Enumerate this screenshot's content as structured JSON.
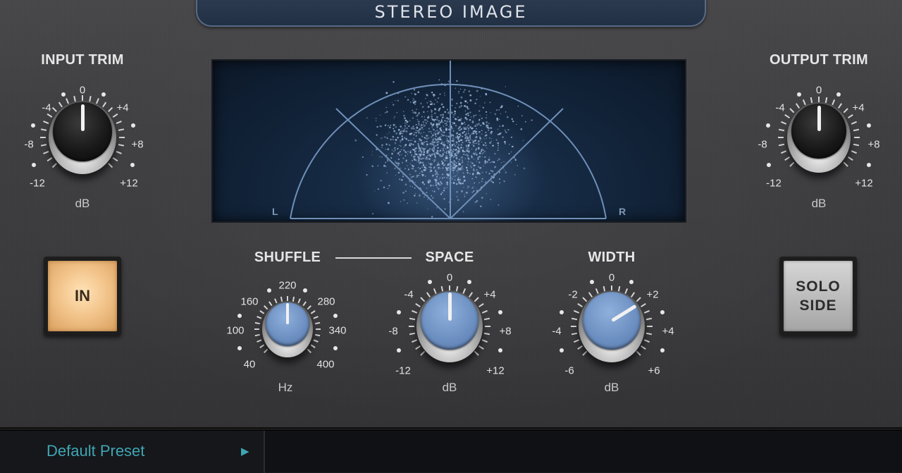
{
  "plugin": {
    "title": "STEREO IMAGE"
  },
  "input_trim": {
    "label": "INPUT TRIM",
    "unit": "dB",
    "scale": [
      "-12",
      "-8",
      "-4",
      "0",
      "+4",
      "+8",
      "+12"
    ],
    "value": "0"
  },
  "output_trim": {
    "label": "OUTPUT TRIM",
    "unit": "dB",
    "scale": [
      "-12",
      "-8",
      "-4",
      "0",
      "+4",
      "+8",
      "+12"
    ],
    "value": "0"
  },
  "scope": {
    "left_label": "L",
    "right_label": "R"
  },
  "shuffle": {
    "label": "SHUFFLE",
    "unit": "Hz",
    "scale": [
      "40",
      "100",
      "160",
      "220",
      "280",
      "340",
      "400"
    ],
    "value": "220"
  },
  "space": {
    "label": "SPACE",
    "unit": "dB",
    "scale": [
      "-12",
      "-8",
      "-4",
      "0",
      "+4",
      "+8",
      "+12"
    ],
    "value": "0"
  },
  "width": {
    "label": "WIDTH",
    "unit": "dB",
    "scale": [
      "-6",
      "-4",
      "-2",
      "0",
      "+2",
      "+4",
      "+6"
    ],
    "value": "+3"
  },
  "in_button": {
    "label": "IN",
    "active": true
  },
  "solo_button": {
    "line1": "SOLO",
    "line2": "SIDE",
    "active": false
  },
  "footer": {
    "preset_name": "Default Preset",
    "preset_arrow_icon": "play-triangle-icon"
  },
  "colors": {
    "accent_blue": "#6d90c2",
    "in_button_amber": "#f3c58c",
    "preset_teal": "#3fa6b3"
  }
}
